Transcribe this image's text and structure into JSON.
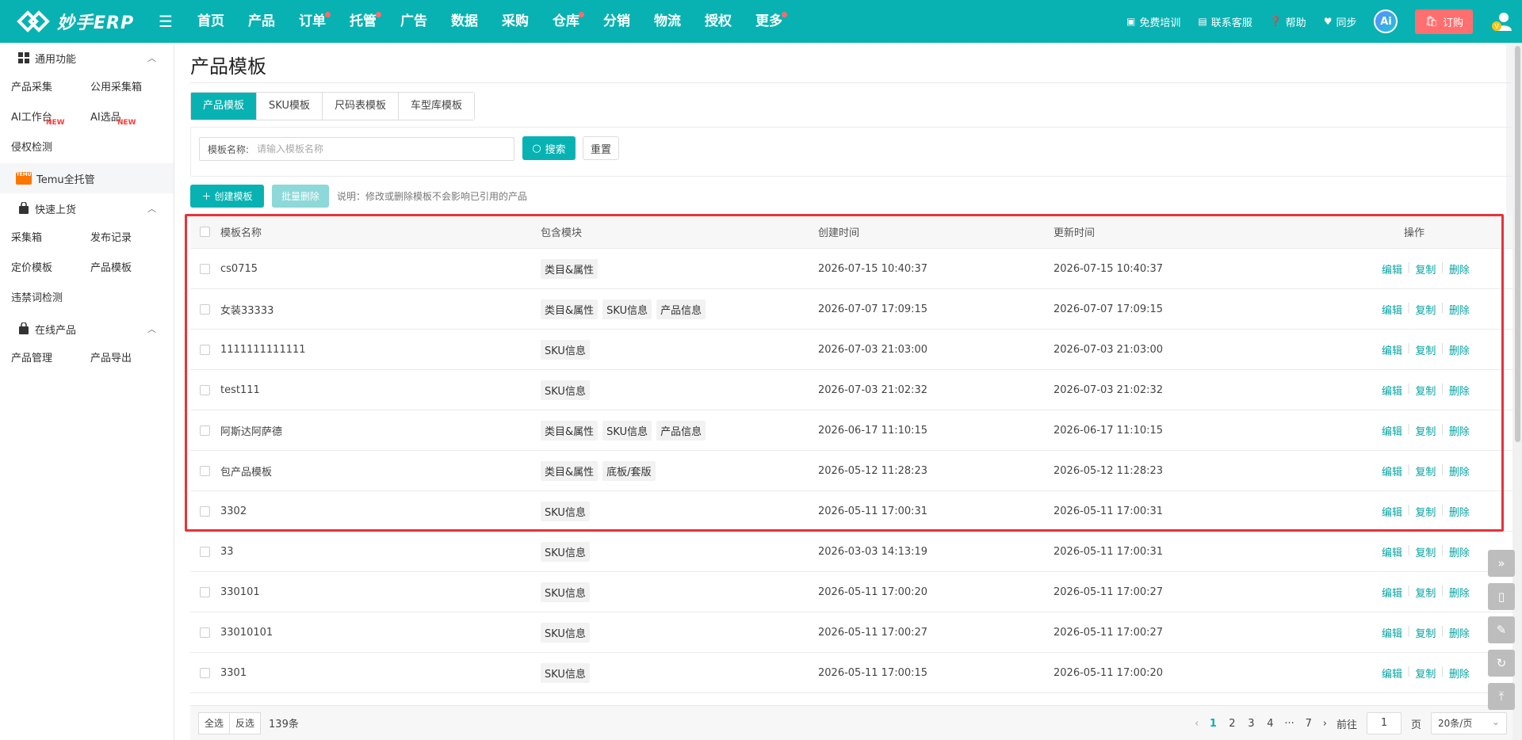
{
  "brand": {
    "name": "妙手ERP",
    "color": "#08b2b2"
  },
  "nav": {
    "items": [
      {
        "label": "首页",
        "dot": false
      },
      {
        "label": "产品",
        "dot": false
      },
      {
        "label": "订单",
        "dot": true
      },
      {
        "label": "托管",
        "dot": true
      },
      {
        "label": "广告",
        "dot": false
      },
      {
        "label": "数据",
        "dot": false
      },
      {
        "label": "采购",
        "dot": false
      },
      {
        "label": "仓库",
        "dot": true
      },
      {
        "label": "分销",
        "dot": false
      },
      {
        "label": "物流",
        "dot": false
      },
      {
        "label": "授权",
        "dot": false
      },
      {
        "label": "更多",
        "dot": true
      }
    ],
    "right": {
      "training": "免费培训",
      "support": "联系客服",
      "help": "帮助",
      "sync": "同步",
      "ai": "Ai",
      "order": "订购"
    }
  },
  "sidebar": {
    "general": {
      "title": "通用功能",
      "items": [
        {
          "label": "产品采集",
          "new": ""
        },
        {
          "label": "公用采集箱",
          "new": ""
        },
        {
          "label": "AI工作台",
          "new": "NEW"
        },
        {
          "label": "AI选品",
          "new": "NEW"
        }
      ],
      "single": "侵权检测",
      "temu": "Temu全托管",
      "temu_logo": "TEMU"
    },
    "quick": {
      "title": "快速上货",
      "items": [
        {
          "label": "采集箱"
        },
        {
          "label": "发布记录"
        },
        {
          "label": "定价模板"
        },
        {
          "label": "产品模板"
        }
      ],
      "single": "违禁词检测"
    },
    "online": {
      "title": "在线产品",
      "items": [
        {
          "label": "产品管理"
        },
        {
          "label": "产品导出"
        }
      ]
    }
  },
  "page": {
    "title": "产品模板",
    "tabs": [
      "产品模板",
      "SKU模板",
      "尺码表模板",
      "车型库模板"
    ],
    "filter": {
      "label": "模板名称:",
      "placeholder": "请输入模板名称",
      "search": "搜索",
      "reset": "重置"
    },
    "create": "创建模板",
    "bulk_delete": "批量删除",
    "note": "说明：修改或删除模板不会影响已引用的产品"
  },
  "table": {
    "headers": {
      "name": "模板名称",
      "modules": "包含模块",
      "created": "创建时间",
      "updated": "更新时间",
      "ops": "操作"
    },
    "ops": {
      "edit": "编辑",
      "copy": "复制",
      "delete": "删除"
    },
    "rows": [
      {
        "name": "cs0715",
        "modules": [
          "类目&属性"
        ],
        "created": "2026-07-15 10:40:37",
        "updated": "2026-07-15 10:40:37"
      },
      {
        "name": "女装33333",
        "modules": [
          "类目&属性",
          "SKU信息",
          "产品信息"
        ],
        "created": "2026-07-07 17:09:15",
        "updated": "2026-07-07 17:09:15"
      },
      {
        "name": "1111111111111",
        "modules": [
          "SKU信息"
        ],
        "created": "2026-07-03 21:03:00",
        "updated": "2026-07-03 21:03:00"
      },
      {
        "name": "test111",
        "modules": [
          "SKU信息"
        ],
        "created": "2026-07-03 21:02:32",
        "updated": "2026-07-03 21:02:32"
      },
      {
        "name": "阿斯达阿萨德",
        "modules": [
          "类目&属性",
          "SKU信息",
          "产品信息"
        ],
        "created": "2026-06-17 11:10:15",
        "updated": "2026-06-17 11:10:15"
      },
      {
        "name": "包产品模板",
        "modules": [
          "类目&属性",
          "底板/套版"
        ],
        "created": "2026-05-12 11:28:23",
        "updated": "2026-05-12 11:28:23"
      },
      {
        "name": "3302",
        "modules": [
          "SKU信息"
        ],
        "created": "2026-05-11 17:00:31",
        "updated": "2026-05-11 17:00:31"
      },
      {
        "name": "33",
        "modules": [
          "SKU信息"
        ],
        "created": "2026-03-03 14:13:19",
        "updated": "2026-05-11 17:00:31"
      },
      {
        "name": "330101",
        "modules": [
          "SKU信息"
        ],
        "created": "2026-05-11 17:00:20",
        "updated": "2026-05-11 17:00:27"
      },
      {
        "name": "33010101",
        "modules": [
          "SKU信息"
        ],
        "created": "2026-05-11 17:00:27",
        "updated": "2026-05-11 17:00:27"
      },
      {
        "name": "3301",
        "modules": [
          "SKU信息"
        ],
        "created": "2026-05-11 17:00:15",
        "updated": "2026-05-11 17:00:20"
      }
    ]
  },
  "footer": {
    "select_all": "全选",
    "invert": "反选",
    "total": "139条",
    "pages": [
      "1",
      "2",
      "3",
      "4",
      "···",
      "7"
    ],
    "goto_label": "前往",
    "goto_value": "1",
    "page_unit": "页",
    "page_size": "20条/页"
  }
}
